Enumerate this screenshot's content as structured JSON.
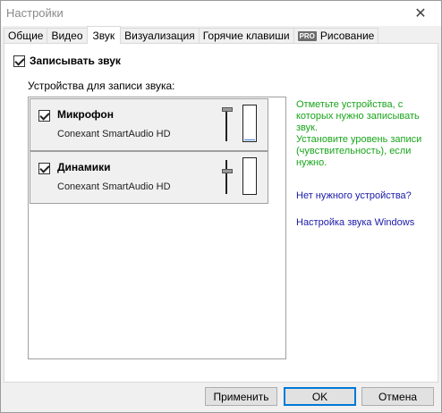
{
  "window": {
    "title": "Настройки",
    "close_glyph": "✕"
  },
  "tabs": [
    {
      "label": "Общие"
    },
    {
      "label": "Видео"
    },
    {
      "label": "Звук",
      "active": true
    },
    {
      "label": "Визуализация"
    },
    {
      "label": "Горячие клавиши"
    },
    {
      "label": "Рисование",
      "badge": "PRO"
    }
  ],
  "sound": {
    "record_label": "Записывать звук",
    "record_checked": true,
    "devices_heading": "Устройства для записи звука:",
    "devices": [
      {
        "name": "Микрофон",
        "driver": "Conexant SmartAudio HD",
        "checked": true,
        "volume": 1.0,
        "level": 0.03
      },
      {
        "name": "Динамики",
        "driver": "Conexant SmartAudio HD",
        "checked": true,
        "volume": 0.7,
        "level": 0.0
      }
    ],
    "hint": "Отметьте устройства, с которых нужно записывать звук.\nУстановите уровень записи (чувствительность), если нужно.",
    "link_missing_device": "Нет нужного устройства?",
    "link_sound_settings": "Настройка звука Windows"
  },
  "buttons": {
    "apply": "Применить",
    "ok": "OK",
    "cancel": "Отмена"
  },
  "colors": {
    "hint": "#18a51a",
    "link": "#1a1aaa",
    "default_button_border": "#0078d7",
    "level_fill": "#3d7ad6"
  }
}
